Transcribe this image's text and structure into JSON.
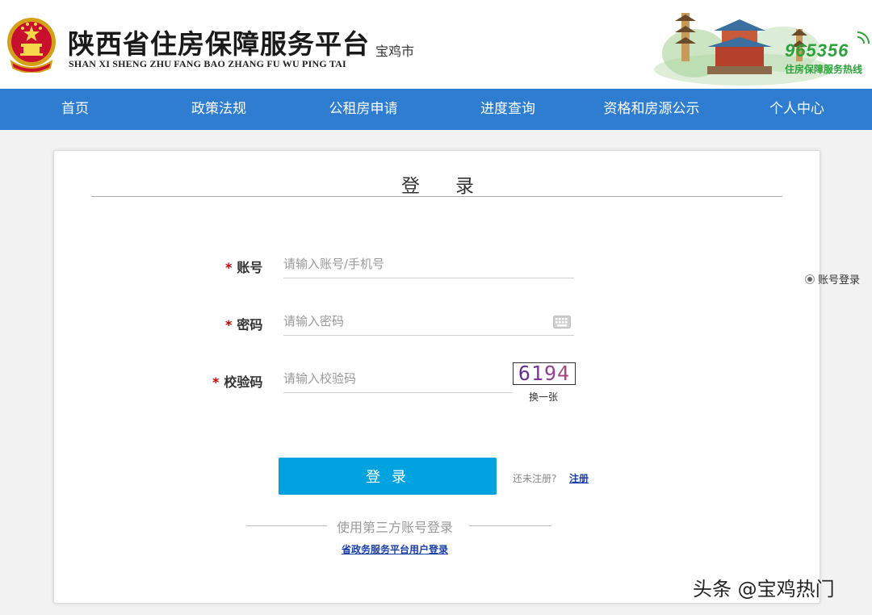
{
  "header": {
    "title": "陕西省住房保障服务平台",
    "subtitle": "SHAN XI SHENG ZHU FANG BAO ZHANG FU WU PING TAI",
    "city": "宝鸡市",
    "hotline_number": "965356",
    "hotline_label": "住房保障服务热线"
  },
  "nav": {
    "items": [
      {
        "label": "首页"
      },
      {
        "label": "政策法规"
      },
      {
        "label": "公租房申请"
      },
      {
        "label": "进度查询"
      },
      {
        "label": "资格和房源公示"
      },
      {
        "label": "个人中心"
      }
    ]
  },
  "login": {
    "title": "登录",
    "fields": {
      "account": {
        "label": "账号",
        "placeholder": "请输入账号/手机号"
      },
      "password": {
        "label": "密码",
        "placeholder": "请输入密码"
      },
      "captcha": {
        "label": "校验码",
        "placeholder": "请输入校验码",
        "image_text": "6194",
        "refresh_label": "换一张"
      }
    },
    "required_mark": "*",
    "submit_label": "登 录",
    "register_hint": "还未注册?",
    "register_link": "注册",
    "third_party_label": "使用第三方账号登录",
    "gov_login_link": "省政务服务平台用户登录"
  },
  "side": {
    "login_mode_label": "账号登录"
  },
  "watermark": "头条 @宝鸡热门",
  "colors": {
    "nav_bg": "#2f7dd1",
    "button_bg": "#00a2e0",
    "hotline_green": "#2ca23a",
    "required_red": "#cc0000",
    "link_blue": "#1a3ea8"
  }
}
